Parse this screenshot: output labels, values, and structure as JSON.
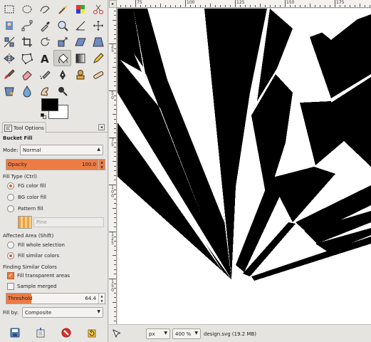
{
  "tool_options": {
    "tab_label": "Tool Options",
    "tab_menu_icon": "tab-menu-icon",
    "title": "Bucket Fill",
    "mode_label": "Mode:",
    "mode_value": "Normal",
    "opacity_label": "Opacity",
    "opacity_value": "100.0",
    "opacity_fraction": 1.0,
    "fill_type_label": "Fill Type  (Ctrl)",
    "fill_types": [
      "FG color fill",
      "BG color fill",
      "Pattern fill"
    ],
    "fill_type_selected": "FG color fill",
    "pattern_name": "Pine",
    "affected_area_label": "Affected Area  (Shift)",
    "affected_areas": [
      "Fill whole selection",
      "Fill similar colors"
    ],
    "affected_area_selected": "Fill similar colors",
    "finding_label": "Finding Similar Colors",
    "fill_transparent_label": "Fill transparent areas",
    "fill_transparent_checked": true,
    "sample_merged_label": "Sample merged",
    "sample_merged_checked": false,
    "threshold_label": "Threshold",
    "threshold_value": "64.4",
    "threshold_fraction": 0.25,
    "fill_by_label": "Fill by:",
    "fill_by_value": "Composite"
  },
  "colors": {
    "foreground": "#000000",
    "background": "#ffffff",
    "accent": "#ec7c45"
  },
  "image_window": {
    "ruler_h_labels": [
      "75",
      "100",
      "125",
      "150",
      "175"
    ],
    "ruler_v_labels": [
      "25",
      "50",
      "75",
      "100",
      "125",
      "150",
      "175"
    ],
    "unit": "px",
    "zoom": "400 %",
    "status": "design.svg (19.2 MB)"
  },
  "tools": [
    "rect-select-icon",
    "ellipse-select-icon",
    "free-select-icon",
    "fuzzy-select-icon",
    "select-by-color-icon",
    "scissors-select-icon",
    "foreground-select-icon",
    "paths-icon",
    "color-picker-icon",
    "zoom-icon",
    "measure-icon",
    "move-icon",
    "align-icon",
    "crop-icon",
    "rotate-icon",
    "scale-icon",
    "shear-icon",
    "perspective-icon",
    "flip-icon",
    "cage-transform-icon",
    "text-icon",
    "bucket-fill-icon",
    "blend-icon",
    "pencil-icon",
    "paintbrush-icon",
    "eraser-icon",
    "airbrush-icon",
    "ink-icon",
    "clone-icon",
    "heal-icon",
    "perspective-clone-icon",
    "blur-icon",
    "smudge-icon",
    "dodge-burn-icon"
  ],
  "active_tool": "bucket-fill-icon",
  "bottom_buttons": [
    "save-options-icon",
    "restore-options-icon",
    "delete-options-icon",
    "reset-options-icon"
  ]
}
